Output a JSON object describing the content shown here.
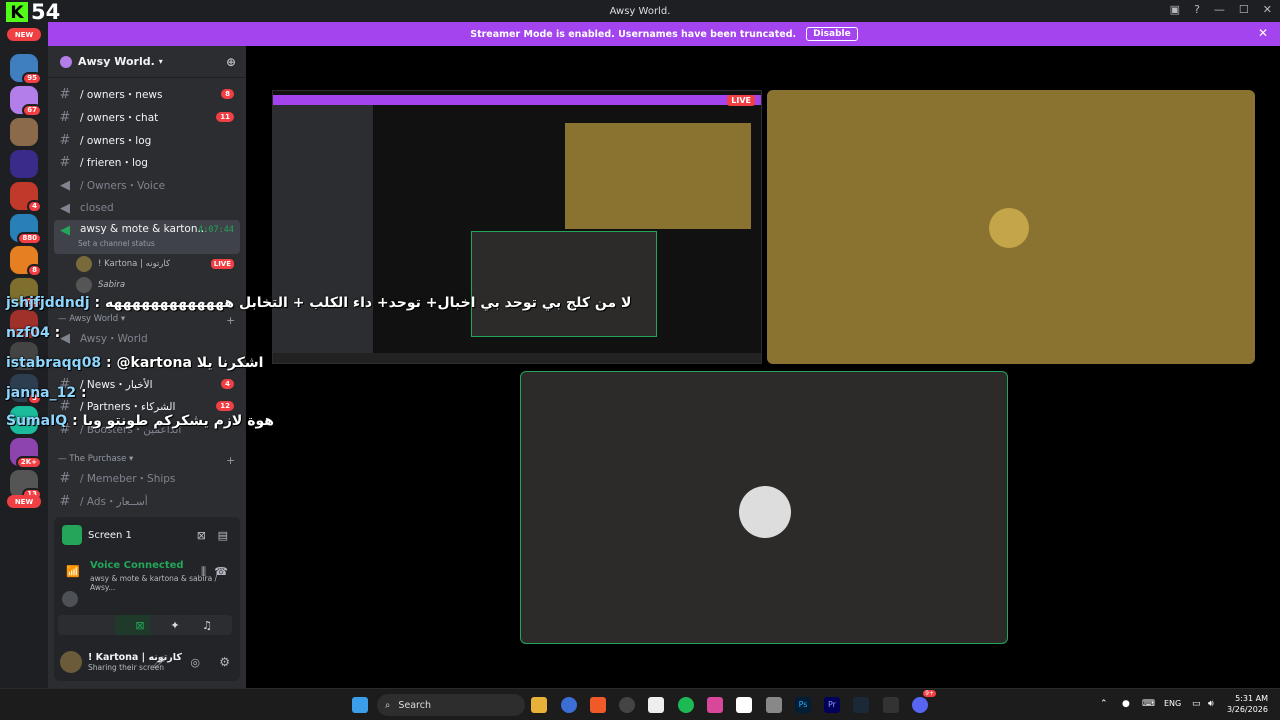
{
  "titlebar": {
    "title": "Awsy World.",
    "kick_logo": "K",
    "kick_count": "54"
  },
  "banner": {
    "text": "Streamer Mode is enabled. Usernames have been truncated.",
    "disable": "Disable"
  },
  "rail": {
    "new_top": "NEW",
    "new_bottom": "NEW",
    "badges": [
      "95",
      "67",
      "4",
      "880",
      "8",
      "21",
      "3",
      "2K+",
      "13"
    ]
  },
  "server": {
    "name": "Awsy World."
  },
  "channels": [
    {
      "label": "/ owners・news",
      "badge": "8"
    },
    {
      "label": "/ owners・chat",
      "badge": "11"
    },
    {
      "label": "/ owners・log"
    },
    {
      "label": "/ frieren・log"
    },
    {
      "label": "/ Owners・Voice"
    },
    {
      "label": "closed"
    },
    {
      "label": "awsy & mote & karton...",
      "timer": "4:07:44",
      "status": "Set a channel status"
    }
  ],
  "voice_users": [
    {
      "name": "! Kartona | كارتونه",
      "live": "LIVE"
    },
    {
      "name": "Sabira"
    }
  ],
  "categories": {
    "awsy_world": "Awsy World",
    "awsy_world_channel": "Awsy・World",
    "news": "/ News・الأخبار",
    "news_badge": "4",
    "partners": "/ Partners・الشركاء",
    "partners_badge": "12",
    "boosters": "/ Boosters・الداعمين",
    "purchase": "The Purchase",
    "ships": "/ Memeber・Ships",
    "ads": "/ Ads・أســعار"
  },
  "overlay_chat": [
    {
      "name": "jshjfjddndj",
      "text": ": لا من كلج بي توحد بي اخبال+ توحد+ داء الكلب + التخابل هههههههههههههه"
    },
    {
      "name": "nzf04",
      "text": ":"
    },
    {
      "name": "istabraqq08",
      "text": ": @kartona اشكرنا يلا"
    },
    {
      "name": "janna_12",
      "text": ":"
    },
    {
      "name": "SumaIQ",
      "text": ": هوة لازم يشكركم طونتو ويا"
    }
  ],
  "bottom_panel": {
    "screen": "Screen 1",
    "voice_connected": "Voice Connected",
    "voice_channel": "awsy & mote & kartona & sabira / Awsy...",
    "user_name": "! Kartona | كارتونه",
    "user_status": "Sharing their screen"
  },
  "stream": {
    "live": "LIVE"
  },
  "taskbar": {
    "search": "Search",
    "lang": "ENG",
    "time": "5:31 AM",
    "date": "3/26/2026",
    "discord_badge": "9+"
  },
  "colors": {
    "accent": "#a344ee",
    "live": "#f23f43",
    "connected": "#23a55a",
    "kick": "#53fc18"
  },
  "icons": [
    "search-icon",
    "mic-icon",
    "headphones-icon",
    "gear-icon",
    "windows-icon",
    "close-icon"
  ]
}
